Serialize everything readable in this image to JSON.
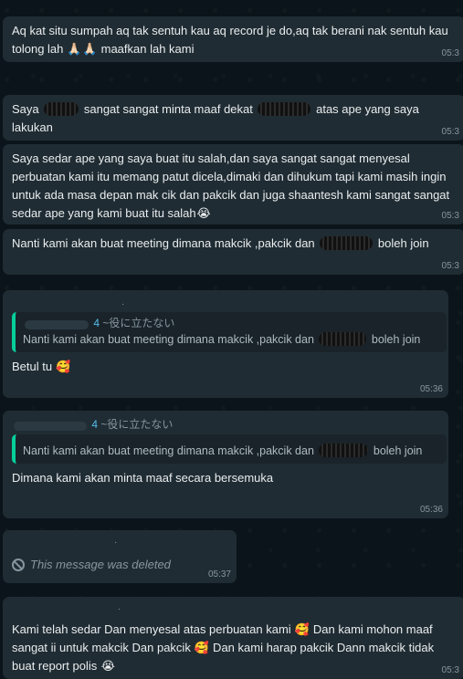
{
  "messages": [
    {
      "text_a": "Aq kat situ sumpah aq tak sentuh kau aq record je do,aq tak berani nak sentuh kau tolong lah ",
      "emoji_a": "🙏🏻",
      "emoji_b": "🙏🏻",
      "text_b": " maafkan lah kami",
      "time": "05:3"
    },
    {
      "text_a": "Saya ",
      "text_b": " sangat sangat minta maaf dekat ",
      "text_c": " atas ape yang saya lakukan",
      "time": "05:3"
    },
    {
      "text_a": "Saya sedar ape yang saya buat itu salah,dan saya sangat sangat menyesal perbuatan kami itu memang patut dicela,dimaki dan dihukum tapi kami masih ingin untuk ada masa depan mak cik dan pakcik dan juga shaantesh kami sangat sangat sedar ape yang kami buat itu salah",
      "emoji_a": "😭",
      "time": "05:3"
    },
    {
      "text_a": "Nanti kami akan buat meeting dimana makcik ,pakcik dan ",
      "text_b": " boleh join",
      "time": "05:3"
    },
    {
      "sender_num": "4",
      "sender_name": "~役に立たない",
      "quote_text_a": "Nanti kami akan buat meeting dimana makcik ,pakcik dan ",
      "quote_text_b": " boleh join",
      "text_a": "Betul tu ",
      "emoji_a": "🥰",
      "time": "05:36"
    },
    {
      "sender_num": "4",
      "sender_name": "~役に立たない",
      "quote_text_a": "Nanti kami akan buat meeting dimana makcik ,pakcik dan ",
      "quote_text_b": " boleh join",
      "text_a": "Dimana kami akan minta maaf secara bersemuka",
      "time": "05:36"
    },
    {
      "deleted_text": "This message was deleted",
      "time": "05:37"
    },
    {
      "text_a": "Kami telah sedar Dan menyesal atas perbuatan kami ",
      "emoji_a": "🥰",
      "text_b": " Dan kami mohon maaf sangat ii untuk makcik Dan pakcik ",
      "emoji_b": "🥰",
      "text_c": " Dan kami harap pakcik Dann makcik tidak buat report polis ",
      "emoji_c": "😭",
      "time": "05:3"
    }
  ],
  "colors": {
    "background": "#0b141a",
    "bubble": "#202c33",
    "quote_bar": "#06cf9c",
    "meta_text": "#8696a0"
  },
  "icons": [
    "ban-icon"
  ]
}
